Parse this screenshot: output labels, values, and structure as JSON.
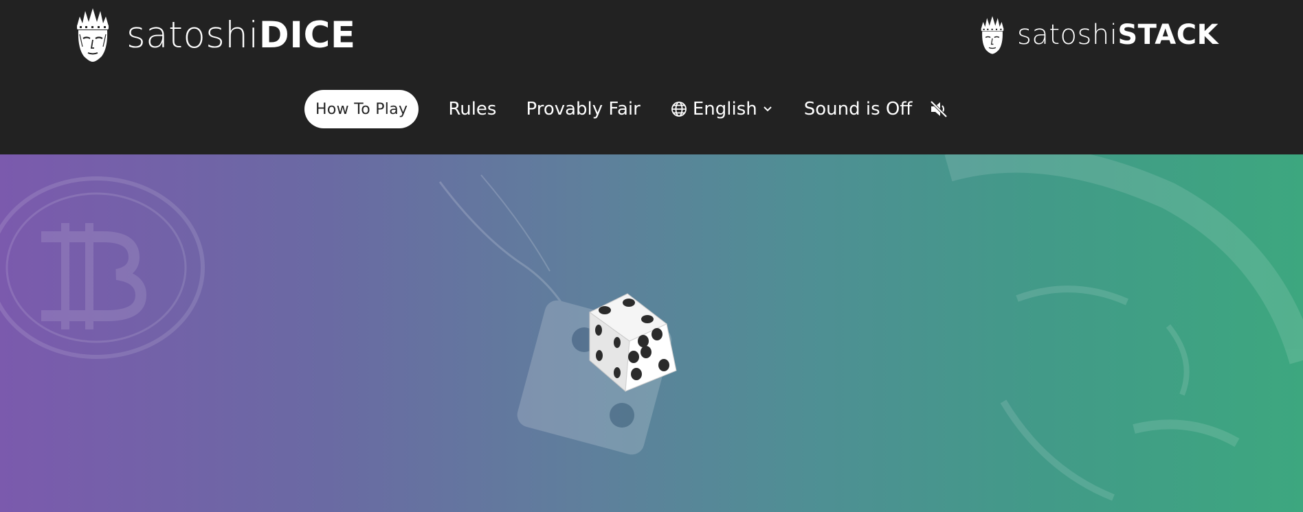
{
  "header": {
    "brand_primary": {
      "light": "satoshi",
      "bold": "DICE"
    },
    "brand_secondary": {
      "light": "satoshi",
      "bold": "STACK"
    },
    "logo_icon": "satoshi-head-icon"
  },
  "nav": {
    "items": [
      {
        "label": "How To Play",
        "active": true
      },
      {
        "label": "Rules"
      },
      {
        "label": "Provably Fair"
      }
    ],
    "language": {
      "label": "English",
      "icon": "globe-icon",
      "caret": "chevron-down-icon"
    },
    "sound": {
      "label": "Sound is Off",
      "icon": "speaker-muted-icon"
    }
  },
  "hero": {
    "background_gradient": [
      "#7b5aad",
      "#5f7f9c",
      "#3da77f"
    ],
    "center_icon": "dice-icon"
  },
  "colors": {
    "header_bg": "#222222",
    "pill_bg": "#ffffff",
    "text_light": "#ffffff"
  }
}
